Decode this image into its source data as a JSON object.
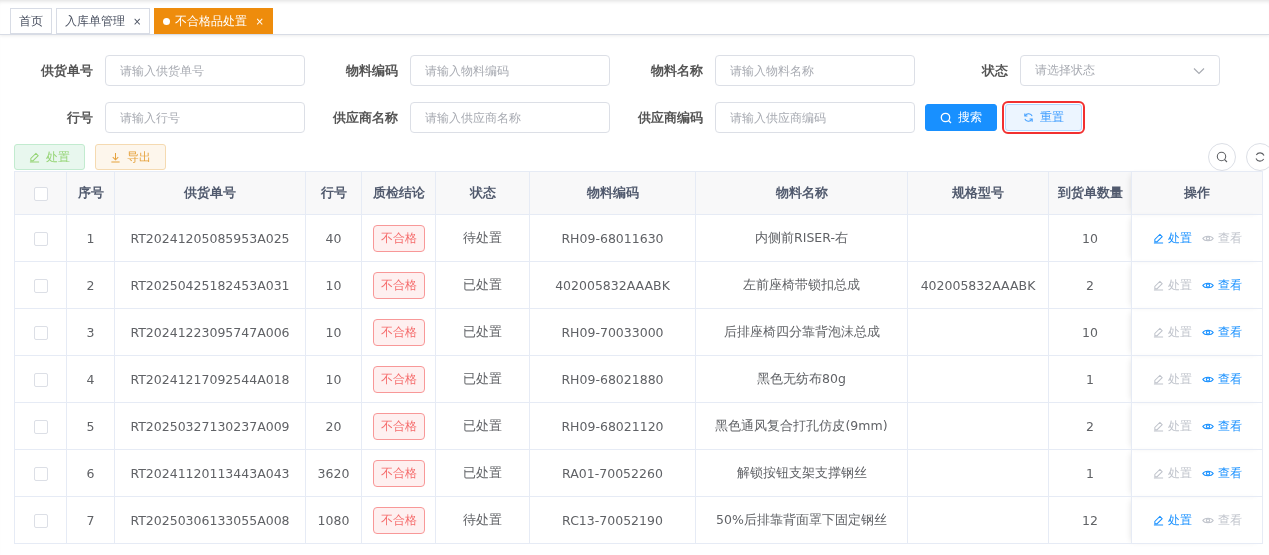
{
  "tabs": [
    {
      "label": "首页",
      "selected": false
    },
    {
      "label": "入库单管理",
      "selected": false,
      "close": "×"
    },
    {
      "label": "不合格品处置",
      "selected": true,
      "close": "×"
    }
  ],
  "filters": [
    {
      "kind": "input",
      "label": "供货单号",
      "placeholder": "请输入供货单号"
    },
    {
      "kind": "input",
      "label": "物料编码",
      "placeholder": "请输入物料编码"
    },
    {
      "kind": "input",
      "label": "物料名称",
      "placeholder": "请输入物料名称"
    },
    {
      "kind": "select",
      "label": "状态",
      "placeholder": "请选择状态"
    },
    {
      "kind": "input",
      "label": "行号",
      "placeholder": "请输入行号"
    },
    {
      "kind": "input",
      "label": "供应商名称",
      "placeholder": "请输入供应商名称"
    },
    {
      "kind": "input",
      "label": "供应商编码",
      "placeholder": "请输入供应商编码"
    }
  ],
  "search_button": "搜索",
  "reset_button": {
    "label": "重置",
    "highlighted": true
  },
  "toolbar": [
    {
      "kind": "handle",
      "label": "处置"
    },
    {
      "kind": "export",
      "label": "导出"
    }
  ],
  "table": {
    "select_all_checked": false,
    "columns": [
      "序号",
      "供货单号",
      "行号",
      "质检结论",
      "状态",
      "物料编码",
      "物料名称",
      "规格型号",
      "到货单数量",
      "操作"
    ],
    "rows": [
      {
        "checked": false,
        "no": "1",
        "order": "RT20241205085953A025",
        "line": "40",
        "result": "不合格",
        "status": "待处置",
        "code": "RH09-68011630",
        "name": "内侧前RISER-右",
        "qty": "10",
        "actions": [
          {
            "kind": "handle",
            "label": "处置",
            "disabled": false
          },
          {
            "kind": "view",
            "label": "查看",
            "disabled": true
          }
        ]
      },
      {
        "checked": false,
        "no": "2",
        "order": "RT20250425182453A031",
        "line": "10",
        "result": "不合格",
        "status": "已处置",
        "code": "402005832AAABK",
        "name": "左前座椅带锁扣总成",
        "spec": "402005832AAABK",
        "qty": "2",
        "actions": [
          {
            "kind": "handle",
            "label": "处置",
            "disabled": true
          },
          {
            "kind": "view",
            "label": "查看",
            "disabled": false
          }
        ]
      },
      {
        "checked": false,
        "no": "3",
        "order": "RT20241223095747A006",
        "line": "10",
        "result": "不合格",
        "status": "已处置",
        "code": "RH09-70033000",
        "name": "后排座椅四分靠背泡沫总成",
        "qty": "10",
        "actions": [
          {
            "kind": "handle",
            "label": "处置",
            "disabled": true
          },
          {
            "kind": "view",
            "label": "查看",
            "disabled": false
          }
        ]
      },
      {
        "checked": false,
        "no": "4",
        "order": "RT20241217092544A018",
        "line": "10",
        "result": "不合格",
        "status": "已处置",
        "code": "RH09-68021880",
        "name": "黑色无纺布80g",
        "qty": "1",
        "actions": [
          {
            "kind": "handle",
            "label": "处置",
            "disabled": true
          },
          {
            "kind": "view",
            "label": "查看",
            "disabled": false
          }
        ]
      },
      {
        "checked": false,
        "no": "5",
        "order": "RT20250327130237A009",
        "line": "20",
        "result": "不合格",
        "status": "已处置",
        "code": "RH09-68021120",
        "name": "黑色通风复合打孔仿皮(9mm)",
        "qty": "2",
        "actions": [
          {
            "kind": "handle",
            "label": "处置",
            "disabled": true
          },
          {
            "kind": "view",
            "label": "查看",
            "disabled": false
          }
        ]
      },
      {
        "checked": false,
        "no": "6",
        "order": "RT20241120113443A043",
        "line": "3620",
        "result": "不合格",
        "status": "已处置",
        "code": "RA01-70052260",
        "name": "解锁按钮支架支撑钢丝",
        "qty": "1",
        "actions": [
          {
            "kind": "handle",
            "label": "处置",
            "disabled": true
          },
          {
            "kind": "view",
            "label": "查看",
            "disabled": false
          }
        ]
      },
      {
        "checked": false,
        "no": "7",
        "order": "RT20250306133055A008",
        "line": "1080",
        "result": "不合格",
        "status": "待处置",
        "code": "RC13-70052190",
        "name": "50%后排靠背面罩下固定钢丝",
        "qty": "12",
        "actions": [
          {
            "kind": "handle",
            "label": "处置",
            "disabled": false
          },
          {
            "kind": "view",
            "label": "查看",
            "disabled": true
          }
        ]
      }
    ]
  }
}
